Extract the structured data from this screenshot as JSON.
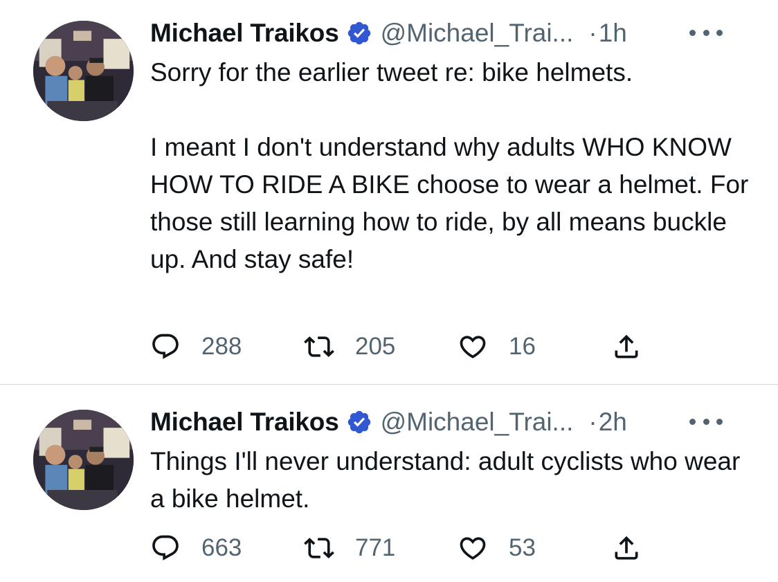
{
  "tweets": [
    {
      "author": "Michael Traikos",
      "handle": "@Michael_Trai...",
      "dot": "·",
      "time": "1h",
      "text": "Sorry for the earlier tweet re: bike helmets.\n\nI meant I don't understand why adults WHO KNOW HOW TO RIDE A BIKE choose to wear a helmet. For those still learning how to ride, by all means buckle up. And stay safe!",
      "replies": "288",
      "retweets": "205",
      "likes": "16"
    },
    {
      "author": "Michael Traikos",
      "handle": "@Michael_Trai...",
      "dot": "·",
      "time": "2h",
      "text": "Things I'll never understand: adult cyclists who wear a bike helmet.",
      "replies": "663",
      "retweets": "771",
      "likes": "53"
    }
  ],
  "icons": {
    "verified": "verified-badge-icon",
    "more": "more-horizontal-icon",
    "reply": "reply-icon",
    "retweet": "retweet-icon",
    "like": "heart-icon",
    "share": "share-icon"
  },
  "colors": {
    "verified_blue": "#3257d3",
    "secondary_text": "#536471",
    "divider": "#cfd9de"
  }
}
